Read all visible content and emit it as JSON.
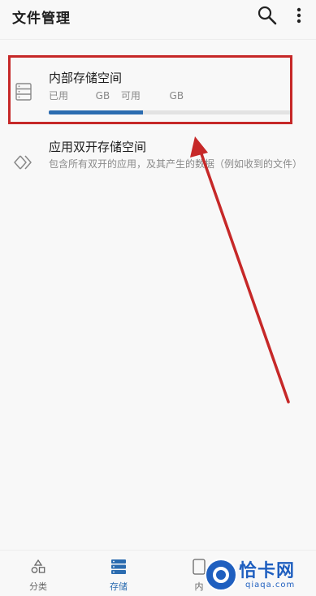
{
  "header": {
    "title": "文件管理"
  },
  "storage": {
    "internal": {
      "title": "内部存储空间",
      "used_label": "已用",
      "used_unit": "GB",
      "free_label": "可用",
      "free_unit": "GB",
      "used_fraction": 0.39
    },
    "dual_app": {
      "title": "应用双开存储空间",
      "description": "包含所有双开的应用，及其产生的数据（例如收到的文件）"
    }
  },
  "bottom_nav": {
    "items": [
      {
        "label": "分类",
        "icon": "category-icon",
        "active": false
      },
      {
        "label": "存储",
        "icon": "storage-icon",
        "active": true
      },
      {
        "label": "内",
        "icon": "device-icon",
        "active": false
      }
    ]
  },
  "watermark": {
    "main": "恰卡网",
    "sub": "qiaqa.com"
  },
  "colors": {
    "accent": "#2b6cb0",
    "annotation": "#c62828"
  }
}
